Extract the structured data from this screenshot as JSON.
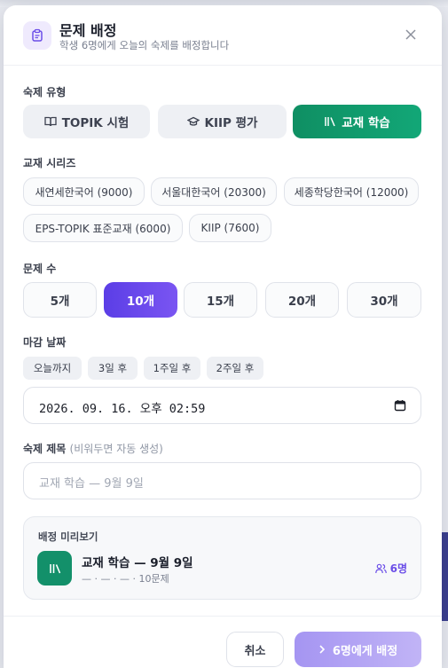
{
  "modal": {
    "title": "문제 배정",
    "subtitle": "학생 6명에게 오늘의 숙제를 배정합니다"
  },
  "homework_type": {
    "label": "숙제 유형",
    "options": [
      {
        "label": "TOPIK 시험",
        "icon": "book-icon",
        "selected": false
      },
      {
        "label": "KIIP 평가",
        "icon": "graduation-cap-icon",
        "selected": false
      },
      {
        "label": "교재 학습",
        "icon": "library-icon",
        "selected": true
      }
    ]
  },
  "textbook_series": {
    "label": "교재 시리즈",
    "options": [
      "새연세한국어 (9000)",
      "서울대한국어 (20300)",
      "세종학당한국어 (12000)",
      "EPS-TOPIK 표준교재 (6000)",
      "KIIP (7600)"
    ]
  },
  "question_count": {
    "label": "문제 수",
    "options": [
      "5개",
      "10개",
      "15개",
      "20개",
      "30개"
    ],
    "selected": "10개"
  },
  "due_date": {
    "label": "마감 날짜",
    "quick_options": [
      "오늘까지",
      "3일 후",
      "1주일 후",
      "2주일 후"
    ],
    "value": "2026. 09. 16. 오후 02:59"
  },
  "homework_title": {
    "label": "숙제 제목",
    "hint": "(비워두면 자동 생성)",
    "placeholder": "교재 학습 — 9월 9일"
  },
  "preview": {
    "label": "배정 미리보기",
    "title": "교재 학습 — 9월 9일",
    "meta": "— · — · — · 10문제",
    "student_count": "6명"
  },
  "footer": {
    "cancel_label": "취소",
    "assign_label": "6명에게 배정"
  },
  "colors": {
    "accent_purple": "#6b4ee8",
    "accent_green": "#12a777"
  }
}
